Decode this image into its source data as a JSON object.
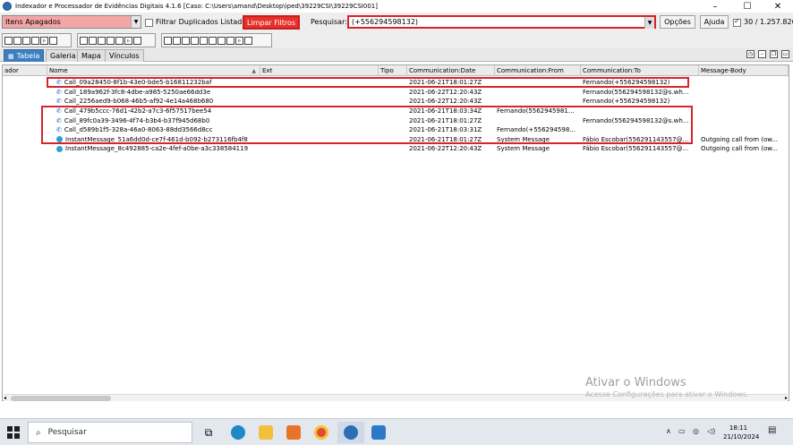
{
  "window": {
    "title": "Indexador e Processador de Evidências Digitais 4.1.6   [Caso: C:\\Users\\amand\\Desktop\\iped\\39229CSI\\39229CSI001]",
    "minimize": "–",
    "maximize": "☐",
    "close": "✕"
  },
  "toolbar": {
    "filter_select": "Itens Apagados",
    "filter_duplicates_label": "Filtrar Duplicados Listados",
    "clear_filters": "Limpar Filtros",
    "search_label": "Pesquisar:",
    "search_value": "(+556294598132)",
    "options": "Opções",
    "help": "Ajuda",
    "count": "30 / 1.257.826"
  },
  "tabs": [
    "Tabela",
    "Galeria",
    "Mapa",
    "Vínculos"
  ],
  "table": {
    "columns": [
      "ador",
      "Nome",
      "Ext",
      "Tipo",
      "Communication:Date",
      "Communication:From",
      "Communication:To",
      "Message-Body"
    ],
    "rows": [
      {
        "icon": "phone-icon",
        "name": "Call_09a28450-8f1b-43e0-bde5-b16811232baf",
        "date": "2021-06-21T18:01:27Z",
        "from": "",
        "to": "Fernando(+556294598132)",
        "body": ""
      },
      {
        "icon": "phone-icon",
        "name": "Call_189a962f-3fc8-4dbe-a985-5250ae66dd3e",
        "date": "2021-06-22T12:20:43Z",
        "from": "",
        "to": "Fernando(556294598132@s.wh...",
        "body": ""
      },
      {
        "icon": "phone-icon",
        "name": "Call_2256aed9-b068-46b5-af92-4e14a468b680",
        "date": "2021-06-22T12:20:43Z",
        "from": "",
        "to": "Fernando(+556294598132)",
        "body": ""
      },
      {
        "icon": "phone-icon",
        "name": "Call_479b5ccc-76d1-42b2-a7c3-6f57517bee54",
        "date": "2021-06-21T18:03:34Z",
        "from": "Fernando(5562945981...",
        "to": "",
        "body": ""
      },
      {
        "icon": "phone-icon",
        "name": "Call_89fc0a39-3496-4f74-b3b4-b37f945d68b0",
        "date": "2021-06-21T18:01:27Z",
        "from": "",
        "to": "Fernando(556294598132@s.wh...",
        "body": ""
      },
      {
        "icon": "phone-icon",
        "name": "Call_d589b1f5-328a-46a0-8063-88dd3566d8cc",
        "date": "2021-06-21T18:03:31Z",
        "from": "Fernando(+556294598...",
        "to": "",
        "body": ""
      },
      {
        "icon": "message-icon",
        "name": "InstantMessage_51a6dd0d-ce7f-461d-b092-b273116fb4f8",
        "date": "2021-06-21T18:01:27Z",
        "from": "System Message",
        "to": "Fábio Escobar(556291143557@...",
        "body": "Outgoing call from (ow..."
      },
      {
        "icon": "message-icon",
        "name": "InstantMessage_8c492885-ca2e-4fef-a0be-a3c338584119",
        "date": "2021-06-22T12:20:43Z",
        "from": "System Message",
        "to": "Fábio Escobar(556291143557@...",
        "body": "Outgoing call from (ow..."
      }
    ]
  },
  "watermark": {
    "line1": "Ativar o Windows",
    "line2": "Acesse Configurações para ativar o Windows."
  },
  "taskbar": {
    "search_placeholder": "Pesquisar",
    "time": "18:11",
    "date": "21/10/2024"
  }
}
